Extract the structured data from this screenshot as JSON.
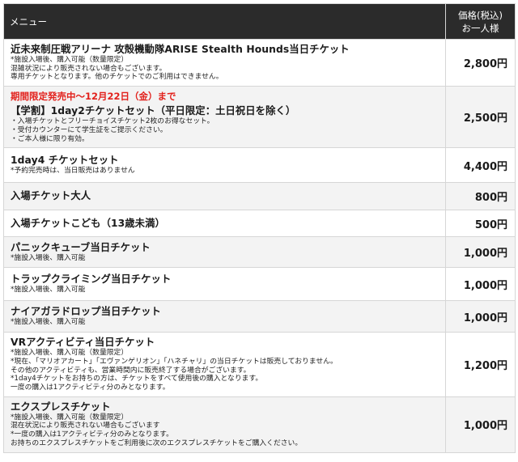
{
  "header": {
    "menu_label": "メニュー",
    "price_label_line1": "価格(税込)",
    "price_label_line2": "お一人様"
  },
  "rows": [
    {
      "name": "近未来制圧戦アリーナ 攻殻機動隊ARISE Stealth Hounds当日チケット",
      "notes": [
        "*施設入場後、購入可能（数量限定）",
        "混雑状況により販売されない場合もございます。",
        "専用チケットとなります。他のチケットでのご利用はできません。"
      ],
      "price": "2,800円"
    },
    {
      "promo": "期間限定発売中～12月22日（金）まで",
      "name": "【学割】1day2チケットセット（平日限定：土日祝日を除く）",
      "notes": [
        "・入場チケットとフリーチョイスチケット2枚のお得なセット。",
        "・受付カウンターにて学生証をご提示ください。",
        "・ご本人様に限り有効。"
      ],
      "price": "2,500円"
    },
    {
      "name": "1day4 チケットセット",
      "notes": [
        "*予約完売時は、当日販売はありません"
      ],
      "price": "4,400円"
    },
    {
      "name": "入場チケット大人",
      "notes": [],
      "price": "800円"
    },
    {
      "name": "入場チケットこども（13歳未満）",
      "notes": [],
      "price": "500円"
    },
    {
      "name": "パニックキューブ当日チケット",
      "notes": [
        "*施設入場後、購入可能"
      ],
      "price": "1,000円"
    },
    {
      "name": "トラップクライミング当日チケット",
      "notes": [
        "*施設入場後、購入可能"
      ],
      "price": "1,000円"
    },
    {
      "name": "ナイアガラドロップ当日チケット",
      "notes": [
        "*施設入場後、購入可能"
      ],
      "price": "1,000円"
    },
    {
      "name": "VRアクティビティ当日チケット",
      "notes": [
        "*施設入場後、購入可能（数量限定）",
        "*現在、「マリオアカート」「エヴァンゲリオン」「ハネチャリ」の当日チケットは販売しておりません。",
        "その他のアクティビティも、営業時間内に販売終了する場合がございます。",
        "*1day4チケットをお持ちの方は、チケットをすべて使用後の購入となります。",
        "一度の購入は1アクティビティ分のみとなります。"
      ],
      "price": "1,200円"
    },
    {
      "name": "エクスプレスチケット",
      "notes": [
        "*施設入場後、購入可能（数量限定）",
        "混在状況により販売されない場合もございます",
        "*一度の購入は1アクティビティ分のみとなります。",
        "お持ちのエクスプレスチケットをご利用後に次のエクスプレスチケットをご購入ください。"
      ],
      "price": "1,000円"
    }
  ]
}
